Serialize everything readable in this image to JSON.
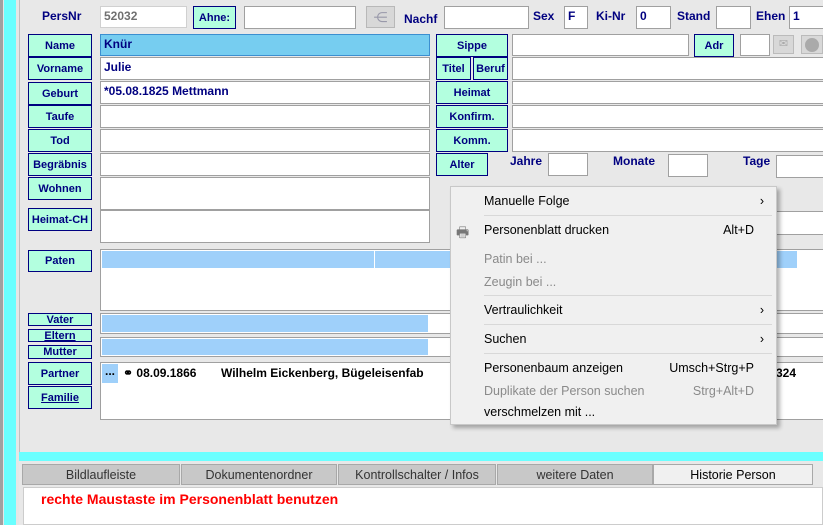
{
  "header": {
    "persnr_label": "PersNr",
    "persnr_value": "52032",
    "ahne_label": "Ahne:",
    "ahne_value": "",
    "nachf_label": "Nachf",
    "nachf_value": "",
    "sex_label": "Sex",
    "sex_value": "F",
    "kinr_label": "Ki-Nr",
    "kinr_value": "0",
    "stand_label": "Stand",
    "stand_value": "",
    "ehen_label": "Ehen",
    "ehen_value": "1"
  },
  "left_fields": [
    {
      "label": "Name",
      "value": "Knür"
    },
    {
      "label": "Vorname",
      "value": "Julie"
    },
    {
      "label": "Geburt",
      "value": "*05.08.1825 Mettmann"
    },
    {
      "label": "Taufe",
      "value": ""
    },
    {
      "label": "Tod",
      "value": ""
    },
    {
      "label": "Begräbnis",
      "value": ""
    },
    {
      "label": "Wohnen",
      "value": ""
    },
    {
      "label": "Heimat-CH",
      "value": ""
    }
  ],
  "right_fields": {
    "sippe": "Sippe",
    "adr": "Adr",
    "titel": "Titel",
    "beruf": "Beruf",
    "heimat": "Heimat",
    "konfirm": "Konfirm.",
    "komm": "Komm.",
    "alter": "Alter",
    "jahre": "Jahre",
    "monate": "Monate",
    "tage": "Tage"
  },
  "relations": {
    "paten": "Paten",
    "vater": "Vater",
    "eltern": "Eltern",
    "mutter": "Mutter",
    "partner": "Partner",
    "familie": "Familie",
    "partner_row": {
      "more": "...",
      "marriage": "⚭ 08.09.1866",
      "name": "Wilhelm Eickenberg, Bügeleisenfab",
      "tail": "324"
    }
  },
  "context_menu": [
    {
      "label": "Manuelle Folge",
      "submenu": true
    },
    {
      "label": "Personenblatt drucken",
      "shortcut": "Alt+D",
      "icon": "printer-icon"
    },
    {
      "label": "Patin bei ...",
      "disabled": true
    },
    {
      "label": "Zeugin bei ...",
      "disabled": true
    },
    {
      "label": "Vertraulichkeit",
      "submenu": true
    },
    {
      "label": "Suchen",
      "submenu": true
    },
    {
      "label": "Personenbaum anzeigen",
      "shortcut": "Umsch+Strg+P"
    },
    {
      "label": "Duplikate der Person suchen",
      "shortcut": "Strg+Alt+D",
      "disabled": true
    },
    {
      "label": "verschmelzen mit ..."
    }
  ],
  "tabs": [
    {
      "label": "Bildlaufleiste"
    },
    {
      "label": "Dokumentenordner"
    },
    {
      "label": "Kontrollschalter / Infos"
    },
    {
      "label": "weitere Daten"
    },
    {
      "label": "Historie Person",
      "active": true
    }
  ],
  "hint": "rechte Maustaste im Personenblatt benutzen",
  "colors": {
    "label": "#000080",
    "button_bg": "#b3ffdf",
    "accent_cyan": "#6affff",
    "selection": "#9fd0fa",
    "hint": "#ff0000"
  }
}
